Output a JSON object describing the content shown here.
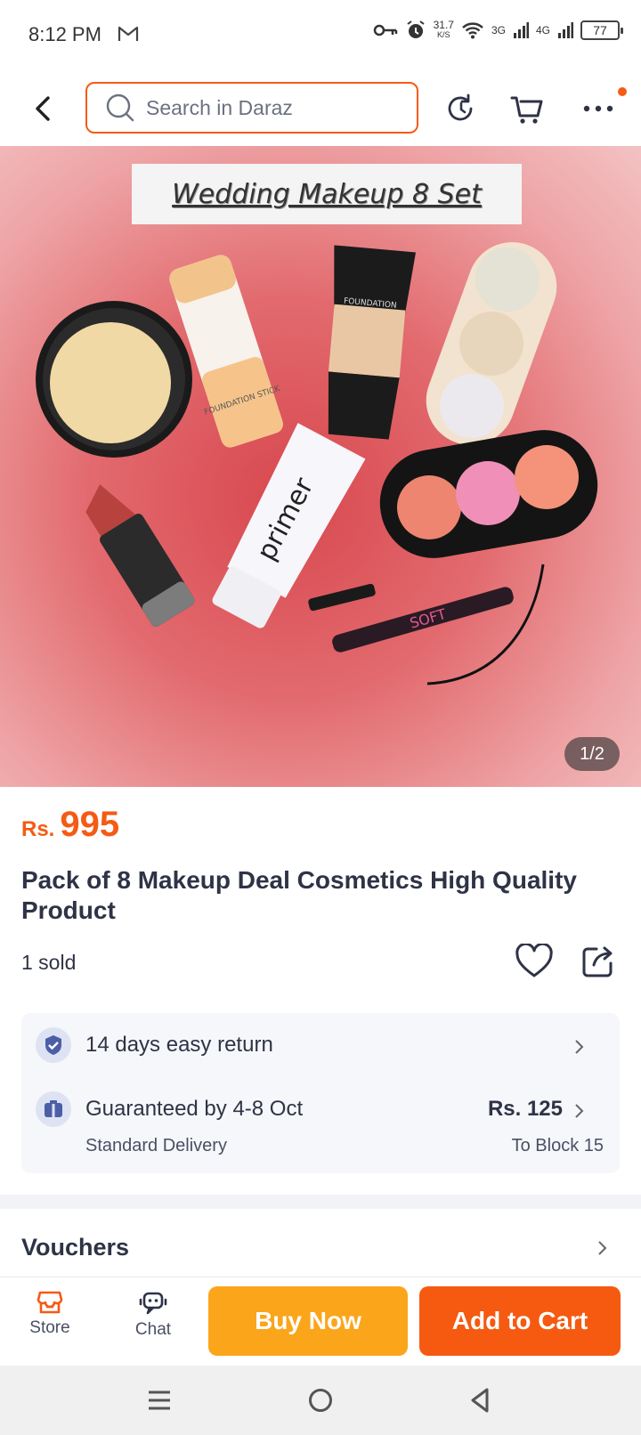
{
  "status_bar": {
    "time": "8:12 PM",
    "net_speed_value": "31.7",
    "net_speed_unit": "K/S",
    "network_3g": "3G",
    "network_4g": "4G",
    "battery": "77"
  },
  "header": {
    "search_placeholder": "Search in Daraz"
  },
  "product_image": {
    "banner_text": "Wedding Makeup 8 Set",
    "counter": "1/2",
    "product_labels": {
      "foundation_tube": "FOUNDATION",
      "foundation_stick": "FOUNDATION STICK",
      "primer": "primer",
      "eyeliner": "SOFT"
    }
  },
  "product": {
    "currency": "Rs.",
    "price": "995",
    "title": "Pack of 8 Makeup Deal Cosmetics High Quality Product",
    "sold": "1 sold"
  },
  "delivery": {
    "return_text": "14 days easy return",
    "guarantee_text": "Guaranteed by 4-8 Oct",
    "delivery_type": "Standard Delivery",
    "fee": "Rs. 125",
    "destination": "To Block 15"
  },
  "vouchers": {
    "label": "Vouchers"
  },
  "bottom_bar": {
    "store_label": "Store",
    "chat_label": "Chat",
    "buy_now_label": "Buy Now",
    "add_to_cart_label": "Add to Cart"
  },
  "colors": {
    "accent": "#f45b14",
    "buy_now": "#fba51b",
    "add_to_cart": "#f55a10",
    "text": "#2e3346"
  }
}
